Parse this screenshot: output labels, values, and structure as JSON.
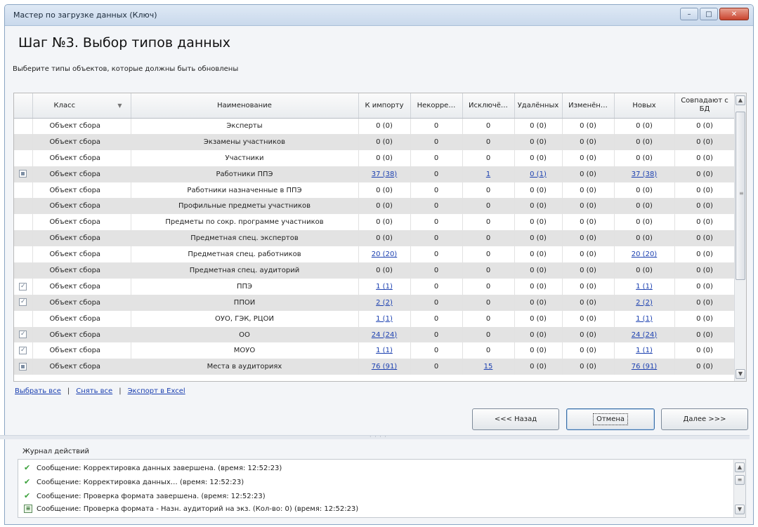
{
  "window": {
    "title": "Мастер по загрузке данных (Ключ)",
    "minimize_glyph": "–",
    "maximize_glyph": "□",
    "close_glyph": "✕"
  },
  "step": {
    "title": "Шаг №3.  Выбор типов данных",
    "subtitle": "Выберите типы объектов, которые должны быть обновлены"
  },
  "grid": {
    "columns": [
      "",
      "Класс",
      "Наименование",
      "К импорту",
      "Некорре…",
      "Исключё…",
      "Удалённых",
      "Изменён…",
      "Новых",
      "Совпадают с БД"
    ],
    "rows": [
      {
        "check": "",
        "class": "Объект сбора",
        "name": "Эксперты",
        "import": "0 (0)",
        "import_link": false,
        "incorrect": "0",
        "excluded": "0",
        "excluded_link": false,
        "deleted": "0 (0)",
        "deleted_link": false,
        "changed": "0 (0)",
        "new": "0 (0)",
        "new_link": false,
        "match": "0 (0)"
      },
      {
        "check": "",
        "class": "Объект сбора",
        "name": "Экзамены участников",
        "import": "0 (0)",
        "import_link": false,
        "incorrect": "0",
        "excluded": "0",
        "excluded_link": false,
        "deleted": "0 (0)",
        "deleted_link": false,
        "changed": "0 (0)",
        "new": "0 (0)",
        "new_link": false,
        "match": "0 (0)"
      },
      {
        "check": "",
        "class": "Объект сбора",
        "name": "Участники",
        "import": "0 (0)",
        "import_link": false,
        "incorrect": "0",
        "excluded": "0",
        "excluded_link": false,
        "deleted": "0 (0)",
        "deleted_link": false,
        "changed": "0 (0)",
        "new": "0 (0)",
        "new_link": false,
        "match": "0 (0)"
      },
      {
        "check": "partial",
        "class": "Объект сбора",
        "name": "Работники ППЭ",
        "import": "37 (38)",
        "import_link": true,
        "incorrect": "0",
        "excluded": "1",
        "excluded_link": true,
        "deleted": "0 (1)",
        "deleted_link": true,
        "changed": "0 (0)",
        "new": "37 (38)",
        "new_link": true,
        "match": "0 (0)"
      },
      {
        "check": "",
        "class": "Объект сбора",
        "name": "Работники назначенные в ППЭ",
        "import": "0 (0)",
        "import_link": false,
        "incorrect": "0",
        "excluded": "0",
        "excluded_link": false,
        "deleted": "0 (0)",
        "deleted_link": false,
        "changed": "0 (0)",
        "new": "0 (0)",
        "new_link": false,
        "match": "0 (0)"
      },
      {
        "check": "",
        "class": "Объект сбора",
        "name": "Профильные предметы участников",
        "import": "0 (0)",
        "import_link": false,
        "incorrect": "0",
        "excluded": "0",
        "excluded_link": false,
        "deleted": "0 (0)",
        "deleted_link": false,
        "changed": "0 (0)",
        "new": "0 (0)",
        "new_link": false,
        "match": "0 (0)"
      },
      {
        "check": "",
        "class": "Объект сбора",
        "name": "Предметы по сокр. программе участников",
        "import": "0 (0)",
        "import_link": false,
        "incorrect": "0",
        "excluded": "0",
        "excluded_link": false,
        "deleted": "0 (0)",
        "deleted_link": false,
        "changed": "0 (0)",
        "new": "0 (0)",
        "new_link": false,
        "match": "0 (0)"
      },
      {
        "check": "",
        "class": "Объект сбора",
        "name": "Предметная спец. экспертов",
        "import": "0 (0)",
        "import_link": false,
        "incorrect": "0",
        "excluded": "0",
        "excluded_link": false,
        "deleted": "0 (0)",
        "deleted_link": false,
        "changed": "0 (0)",
        "new": "0 (0)",
        "new_link": false,
        "match": "0 (0)"
      },
      {
        "check": "",
        "class": "Объект сбора",
        "name": "Предметная спец. работников",
        "import": "20 (20)",
        "import_link": true,
        "incorrect": "0",
        "excluded": "0",
        "excluded_link": false,
        "deleted": "0 (0)",
        "deleted_link": false,
        "changed": "0 (0)",
        "new": "20 (20)",
        "new_link": true,
        "match": "0 (0)"
      },
      {
        "check": "",
        "class": "Объект сбора",
        "name": "Предметная спец. аудиторий",
        "import": "0 (0)",
        "import_link": false,
        "incorrect": "0",
        "excluded": "0",
        "excluded_link": false,
        "deleted": "0 (0)",
        "deleted_link": false,
        "changed": "0 (0)",
        "new": "0 (0)",
        "new_link": false,
        "match": "0 (0)"
      },
      {
        "check": "checked",
        "class": "Объект сбора",
        "name": "ППЭ",
        "import": "1 (1)",
        "import_link": true,
        "incorrect": "0",
        "excluded": "0",
        "excluded_link": false,
        "deleted": "0 (0)",
        "deleted_link": false,
        "changed": "0 (0)",
        "new": "1 (1)",
        "new_link": true,
        "match": "0 (0)"
      },
      {
        "check": "checked",
        "class": "Объект сбора",
        "name": "ППОИ",
        "import": "2 (2)",
        "import_link": true,
        "incorrect": "0",
        "excluded": "0",
        "excluded_link": false,
        "deleted": "0 (0)",
        "deleted_link": false,
        "changed": "0 (0)",
        "new": "2 (2)",
        "new_link": true,
        "match": "0 (0)"
      },
      {
        "check": "",
        "class": "Объект сбора",
        "name": "ОУО, ГЭК, РЦОИ",
        "import": "1 (1)",
        "import_link": true,
        "incorrect": "0",
        "excluded": "0",
        "excluded_link": false,
        "deleted": "0 (0)",
        "deleted_link": false,
        "changed": "0 (0)",
        "new": "1 (1)",
        "new_link": true,
        "match": "0 (0)"
      },
      {
        "check": "checked",
        "class": "Объект сбора",
        "name": "ОО",
        "import": "24 (24)",
        "import_link": true,
        "incorrect": "0",
        "excluded": "0",
        "excluded_link": false,
        "deleted": "0 (0)",
        "deleted_link": false,
        "changed": "0 (0)",
        "new": "24 (24)",
        "new_link": true,
        "match": "0 (0)"
      },
      {
        "check": "checked",
        "class": "Объект сбора",
        "name": "МОУО",
        "import": "1 (1)",
        "import_link": true,
        "incorrect": "0",
        "excluded": "0",
        "excluded_link": false,
        "deleted": "0 (0)",
        "deleted_link": false,
        "changed": "0 (0)",
        "new": "1 (1)",
        "new_link": true,
        "match": "0 (0)"
      },
      {
        "check": "partial",
        "class": "Объект сбора",
        "name": "Места в аудиториях",
        "import": "76 (91)",
        "import_link": true,
        "incorrect": "0",
        "excluded": "15",
        "excluded_link": true,
        "deleted": "0 (0)",
        "deleted_link": false,
        "changed": "0 (0)",
        "new": "76 (91)",
        "new_link": true,
        "match": "0 (0)"
      }
    ]
  },
  "links": {
    "select_all": "Выбрать все",
    "deselect_all": "Снять все",
    "export_excel": "Экспорт в Excel",
    "separator": "|"
  },
  "buttons": {
    "back": "<<< Назад",
    "cancel": "Отмена",
    "next": "Далее >>>"
  },
  "log": {
    "title": "Журнал действий",
    "entries": [
      {
        "icon": "check-icon",
        "text": "Сообщение: Корректировка данных завершена. (время: 12:52:23)"
      },
      {
        "icon": "check-icon",
        "text": "Сообщение: Корректировка данных… (время: 12:52:23)"
      },
      {
        "icon": "check-icon",
        "text": "Сообщение: Проверка формата завершена. (время: 12:52:23)"
      },
      {
        "icon": "document-icon",
        "text": "Сообщение: Проверка формата - Назн. аудиторий на экз.  (Кол-во: 0) (время: 12:52:23)"
      }
    ]
  },
  "colors": {
    "link": "#1a3fb0",
    "alt_row": "#e3e3e3",
    "ok_icon": "#3ba13b"
  }
}
